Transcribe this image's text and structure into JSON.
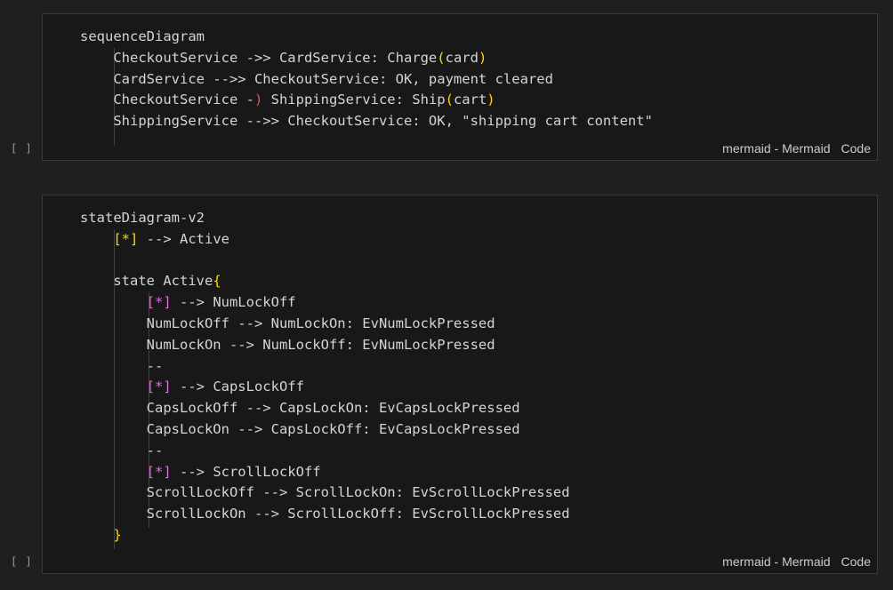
{
  "cells": [
    {
      "execution_count": "[ ]",
      "language_label": "mermaid - Mermaid",
      "cell_type_label": "Code",
      "code": {
        "l1": "sequenceDiagram",
        "l2a": "    CheckoutService ->> CardService: Charge",
        "l2b": "(",
        "l2c": "card",
        "l2d": ")",
        "l3": "    CardService -->> CheckoutService: OK, payment cleared",
        "l4a": "    CheckoutService -",
        "l4b": ")",
        "l4c": " ShippingService: Ship",
        "l4d": "(",
        "l4e": "cart",
        "l4f": ")",
        "l5": "    ShippingService -->> CheckoutService: OK, \"shipping cart content\""
      }
    },
    {
      "execution_count": "[ ]",
      "language_label": "mermaid - Mermaid",
      "cell_type_label": "Code",
      "code": {
        "l1": "stateDiagram-v2",
        "l2a": "    ",
        "l2b": "[*]",
        "l2c": " --> Active",
        "l3": "",
        "l4a": "    state Active",
        "l4b": "{",
        "l5a": "        ",
        "l5b": "[*]",
        "l5c": " --> NumLockOff",
        "l6": "        NumLockOff --> NumLockOn: EvNumLockPressed",
        "l7": "        NumLockOn --> NumLockOff: EvNumLockPressed",
        "l8": "        --",
        "l9a": "        ",
        "l9b": "[*]",
        "l9c": " --> CapsLockOff",
        "l10": "        CapsLockOff --> CapsLockOn: EvCapsLockPressed",
        "l11": "        CapsLockOn --> CapsLockOff: EvCapsLockPressed",
        "l12": "        --",
        "l13a": "        ",
        "l13b": "[*]",
        "l13c": " --> ScrollLockOff",
        "l14": "        ScrollLockOff --> ScrollLockOn: EvScrollLockPressed",
        "l15": "        ScrollLockOn --> ScrollLockOff: EvScrollLockPressed",
        "l16a": "    ",
        "l16b": "}"
      }
    }
  ],
  "colors": {
    "background": "#1f1f1f",
    "cell_background": "#181818",
    "text": "#d4d4d4",
    "bracket_yellow": "#ffd700",
    "bracket_red": "#f14c4c",
    "bracket_purple": "#da70d6"
  }
}
